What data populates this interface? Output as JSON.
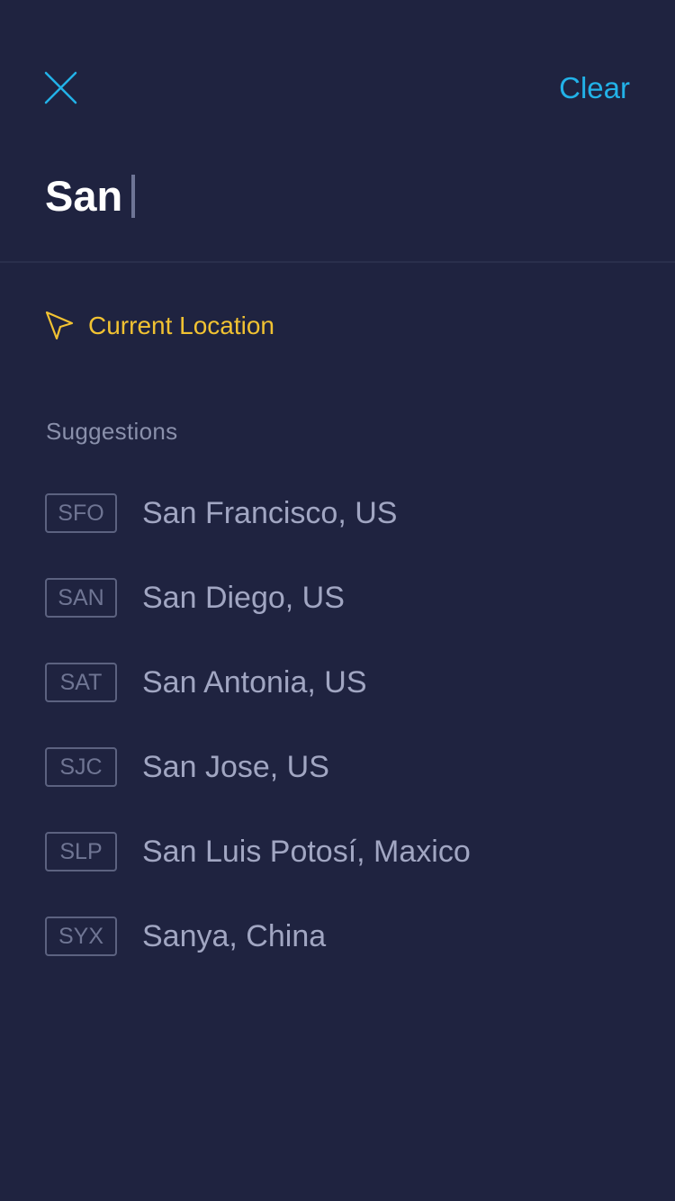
{
  "header": {
    "close_icon": "close-icon",
    "clear_label": "Clear",
    "accent_color": "#22b2e8"
  },
  "search": {
    "value": "San"
  },
  "current_location": {
    "icon": "location-arrow-icon",
    "label": "Current Location",
    "color": "#f1c232"
  },
  "suggestions": {
    "title": "Suggestions",
    "items": [
      {
        "code": "SFO",
        "city": "San Francisco, US"
      },
      {
        "code": "SAN",
        "city": "San Diego, US"
      },
      {
        "code": "SAT",
        "city": "San Antonia, US"
      },
      {
        "code": "SJC",
        "city": "San Jose, US"
      },
      {
        "code": "SLP",
        "city": "San Luis Potosí, Maxico"
      },
      {
        "code": "SYX",
        "city": "Sanya, China"
      }
    ]
  },
  "theme": {
    "background": "#1f2340"
  }
}
